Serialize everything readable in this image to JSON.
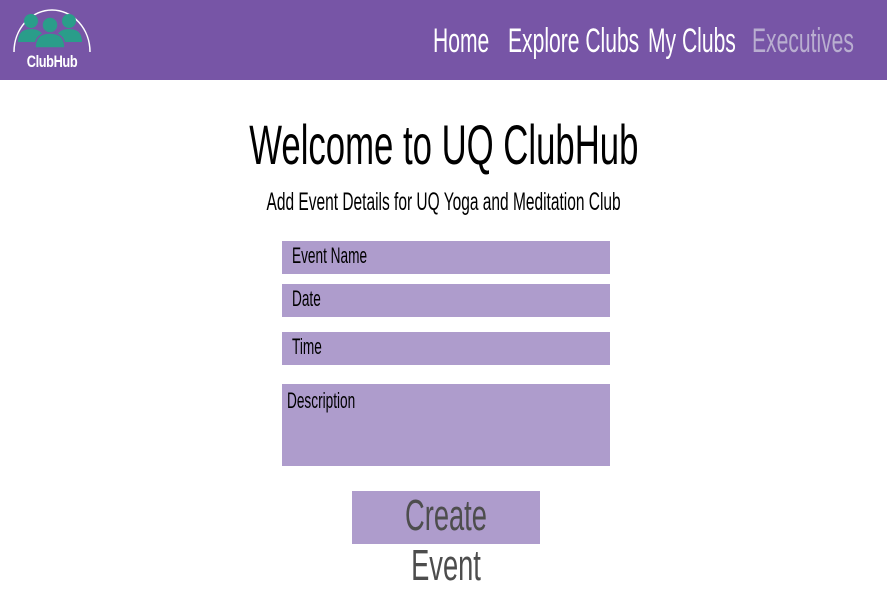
{
  "brand": {
    "name": "ClubHub",
    "icon_color": "#2a9d8a"
  },
  "nav": {
    "items": [
      {
        "label": "Home",
        "active": false
      },
      {
        "label": "Explore Clubs",
        "active": false
      },
      {
        "label": "My Clubs",
        "active": false
      },
      {
        "label": "Executives",
        "active": true
      }
    ]
  },
  "main": {
    "title": "Welcome to UQ ClubHub",
    "subtitle": "Add Event Details for UQ Yoga and Meditation Club"
  },
  "form": {
    "event_name_placeholder": "Event Name",
    "date_placeholder": "Date",
    "time_placeholder": "Time",
    "description_placeholder": "Description",
    "submit_label": "Create Event"
  },
  "colors": {
    "navbar": "#7755a6",
    "field": "#ae9ccc",
    "active_nav": "#b9aed0"
  }
}
